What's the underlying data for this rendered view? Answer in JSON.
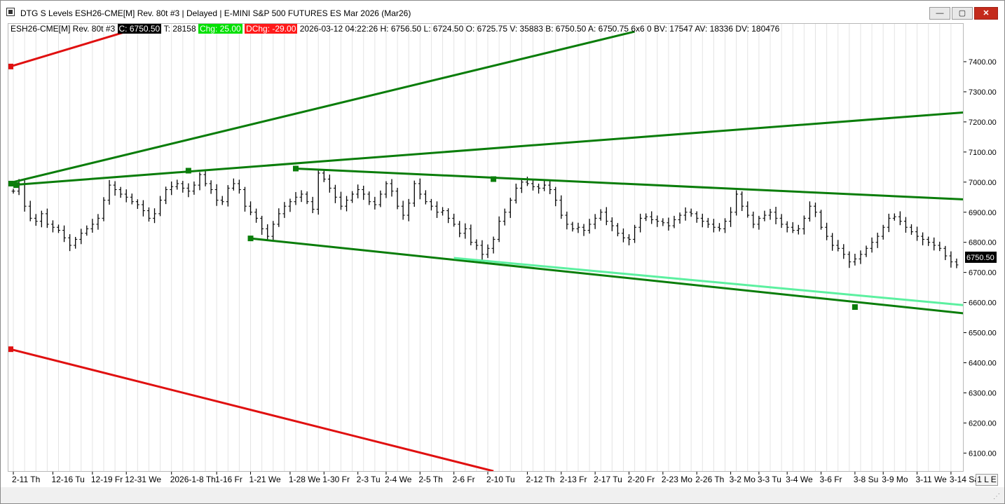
{
  "window": {
    "title": "DTG S Levels ESH26-CME[M]  Rev. 80t #3 | Delayed | E-MINI S&P 500 FUTURES ES Mar 2026 (Mar26)",
    "buttons": {
      "minimize": "—",
      "maximize": "▢",
      "close": "✕"
    }
  },
  "status": {
    "symbol": "ESH26-CME[M]  Rev. 80t #3",
    "close": "C: 6750.50",
    "trades": "T: 28158",
    "chg": "Chg: 25.00",
    "dchg": "DChg: -29.00",
    "rest": "2026-03-12 04:22:26 H: 6756.50 L: 6724.50 O: 6725.75 V: 35883 B: 6750.50 A: 6750.75 6x6 0 BV: 17547 AV: 18336 DV: 180476"
  },
  "axis_mode_label": "1 L E",
  "colors": {
    "price_bars": "#000000",
    "channel_lines": "#0a7d0a",
    "light_channel_line": "#5cf0a0",
    "red_lines": "#e01010",
    "grid": "#e4e4e4",
    "last_price_box": "#000000"
  },
  "chart_data": {
    "type": "ohlc-bar",
    "title": "",
    "xlabel": "",
    "ylabel": "",
    "ylim": [
      6040,
      7500
    ],
    "y_ticks": [
      "7400.00",
      "7300.00",
      "7200.00",
      "7100.00",
      "7000.00",
      "6900.00",
      "6800.00",
      "6700.00",
      "6600.00",
      "6500.00",
      "6400.00",
      "6300.00",
      "6200.00",
      "6100.00"
    ],
    "last_price": 6750.5,
    "last_price_label": "6750.50",
    "x_ticks": [
      {
        "label": "2-11 Th",
        "i": 0
      },
      {
        "label": "12-16 Tu",
        "i": 7
      },
      {
        "label": "12-19 Fr",
        "i": 14
      },
      {
        "label": "12-31 We",
        "i": 20
      },
      {
        "label": "2026-1-8 Th",
        "i": 28
      },
      {
        "label": "1-16 Fr",
        "i": 36
      },
      {
        "label": "1-21 We",
        "i": 42
      },
      {
        "label": "1-28 We",
        "i": 49
      },
      {
        "label": "1-30 Fr",
        "i": 55
      },
      {
        "label": "2-3 Tu",
        "i": 61
      },
      {
        "label": "2-4 We",
        "i": 66
      },
      {
        "label": "2-5 Th",
        "i": 72
      },
      {
        "label": "2-6 Fr",
        "i": 78
      },
      {
        "label": "2-10 Tu",
        "i": 84
      },
      {
        "label": "2-12 Th",
        "i": 91
      },
      {
        "label": "2-13 Fr",
        "i": 97
      },
      {
        "label": "2-17 Tu",
        "i": 103
      },
      {
        "label": "2-20 Fr",
        "i": 109
      },
      {
        "label": "2-23 Mo",
        "i": 115
      },
      {
        "label": "2-26 Th",
        "i": 121
      },
      {
        "label": "3-2 Mo",
        "i": 127
      },
      {
        "label": "3-3 Tu",
        "i": 132
      },
      {
        "label": "3-4 We",
        "i": 137
      },
      {
        "label": "3-6 Fr",
        "i": 143
      },
      {
        "label": "3-8 Su",
        "i": 149
      },
      {
        "label": "3-9 Mo",
        "i": 154
      },
      {
        "label": "3-11 We",
        "i": 160
      },
      {
        "label": "3-14 Sa",
        "i": 166
      }
    ],
    "x_count": 168,
    "closes": [
      6970,
      6995,
      6920,
      6880,
      6870,
      6895,
      6860,
      6850,
      6840,
      6815,
      6790,
      6810,
      6830,
      6845,
      6860,
      6880,
      6940,
      6990,
      6975,
      6960,
      6950,
      6935,
      6925,
      6905,
      6880,
      6895,
      6940,
      6975,
      6985,
      6995,
      6980,
      6970,
      6990,
      7025,
      6995,
      6975,
      6940,
      6935,
      6980,
      6995,
      6975,
      6920,
      6900,
      6880,
      6845,
      6820,
      6860,
      6895,
      6920,
      6935,
      6950,
      6960,
      6935,
      6910,
      7030,
      7010,
      6980,
      6950,
      6920,
      6940,
      6960,
      6975,
      6960,
      6935,
      6925,
      6960,
      6995,
      6970,
      6920,
      6890,
      6930,
      6995,
      6960,
      6935,
      6920,
      6900,
      6905,
      6880,
      6860,
      6830,
      6845,
      6800,
      6790,
      6760,
      6780,
      6810,
      6870,
      6900,
      6940,
      6980,
      7000,
      6995,
      6985,
      6980,
      6990,
      6975,
      6940,
      6890,
      6860,
      6845,
      6850,
      6840,
      6860,
      6880,
      6900,
      6870,
      6855,
      6830,
      6815,
      6810,
      6850,
      6880,
      6885,
      6875,
      6870,
      6865,
      6855,
      6875,
      6890,
      6900,
      6895,
      6880,
      6870,
      6860,
      6850,
      6845,
      6870,
      6900,
      6960,
      6920,
      6890,
      6860,
      6880,
      6890,
      6900,
      6880,
      6860,
      6850,
      6840,
      6845,
      6880,
      6920,
      6900,
      6850,
      6820,
      6790,
      6780,
      6760,
      6735,
      6745,
      6760,
      6780,
      6800,
      6820,
      6850,
      6880,
      6885,
      6870,
      6850,
      6835,
      6820,
      6810,
      6800,
      6790,
      6780,
      6755,
      6735,
      6725
    ],
    "series": [
      {
        "name": "",
        "kind": "channel",
        "points": [
          [
            -0.5,
            6990
          ],
          [
            177,
            7244
          ]
        ]
      },
      {
        "name": "",
        "kind": "channel",
        "points": [
          [
            -0.5,
            6998
          ],
          [
            110,
            7500
          ]
        ]
      },
      {
        "name": "",
        "kind": "channel",
        "points": [
          [
            50,
            7045
          ],
          [
            177,
            6935
          ]
        ]
      },
      {
        "name": "",
        "kind": "channel",
        "points": [
          [
            42,
            6813
          ],
          [
            177,
            6547
          ]
        ]
      },
      {
        "name": "",
        "kind": "channel-light",
        "points": [
          [
            78,
            6748
          ],
          [
            177,
            6576
          ]
        ]
      },
      {
        "name": "",
        "kind": "red",
        "points": [
          [
            -0.5,
            7384
          ],
          [
            20,
            7500
          ]
        ]
      },
      {
        "name": "",
        "kind": "red",
        "points": [
          [
            -0.5,
            6445
          ],
          [
            85,
            6040
          ]
        ]
      }
    ],
    "markers": [
      {
        "x": -0.5,
        "y": 6995,
        "color": "#0a7d0a"
      },
      {
        "x": 0.5,
        "y": 6990,
        "color": "#0a7d0a"
      },
      {
        "x": 31,
        "y": 7038,
        "color": "#0a7d0a"
      },
      {
        "x": 50,
        "y": 7045,
        "color": "#0a7d0a"
      },
      {
        "x": 42,
        "y": 6813,
        "color": "#0a7d0a"
      },
      {
        "x": 85,
        "y": 7010,
        "color": "#0a7d0a"
      },
      {
        "x": 149,
        "y": 6585,
        "color": "#0a7d0a"
      },
      {
        "x": -0.5,
        "y": 7384,
        "color": "#e01010"
      },
      {
        "x": -0.5,
        "y": 6445,
        "color": "#e01010"
      }
    ],
    "grid": "vertical"
  }
}
